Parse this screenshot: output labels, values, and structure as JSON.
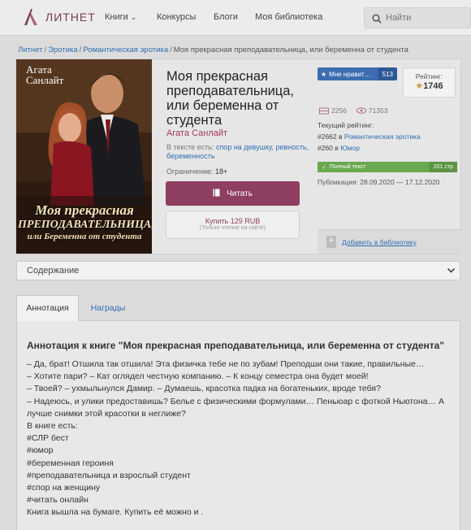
{
  "header": {
    "logo_text": "ЛИТНЕТ",
    "nav": {
      "books": "Книги",
      "contests": "Конкурсы",
      "blogs": "Блоги",
      "library": "Моя библиотека"
    },
    "search_placeholder": "Найти"
  },
  "breadcrumb": {
    "items": [
      "Литнет",
      "Эротика",
      "Романтическая эротика"
    ],
    "current": "Моя прекрасная преподавательница, или беременна от студента",
    "separator": "/"
  },
  "book": {
    "cover": {
      "author": [
        "Агата",
        "Санлайт"
      ],
      "title": [
        "Моя прекрасная",
        "ПРЕПОДАВАТЕЛЬНИЦА,",
        "или Беременна от студента"
      ]
    },
    "title": "Моя прекрасная преподавательница, или беременна от студента",
    "author": "Агата Санлайт",
    "tags_label": "В тексте есть:",
    "tags": "спор на девушку, ревность, беременность",
    "age_label": "Ограничение:",
    "age": "18+",
    "read_label": "Читать",
    "buy_label": "Купить 129 RUB",
    "buy_note": "(Только чтение на сайте)"
  },
  "stats": {
    "like_label": "Мне нравит…",
    "like_count": "513",
    "rating_label": "Рейтинг:",
    "rating_value": "1746",
    "library_count": "2256",
    "views_count": "71353",
    "current_rating_label": "Текущий рейтинг:",
    "rank1_number": "#2662",
    "rank1_in": "в",
    "rank1_genre": "Романтическая эротика",
    "rank2_number": "#260",
    "rank2_in": "в",
    "rank2_genre": "Юмор",
    "status": "Полный текст",
    "pages": "201 стр",
    "publication": "Публикация: 28.09.2020 — 17.12.2020",
    "add_library": "Добавить в библиотеку"
  },
  "contents": {
    "label": "Содержание"
  },
  "tabs": {
    "annotation": "Аннотация",
    "awards": "Награды"
  },
  "annotation": {
    "heading": "Аннотация к книге \"Моя прекрасная преподавательница, или беременна от студента\"",
    "lines": [
      "– Да, брат! Отшила так отшила! Эта физичка тебе не по зубам! Преподши они такие, правильные…",
      "– Хотите пари? – Кат оглядел честную компанию. – К концу семестра она будет моей!",
      "– Твоей? – ухмыльнулся Дамир. – Думаешь, красотка падка на богатеньких, вроде тебя?",
      "– Надеюсь, и улики предоставишь? Белье с физическими формулами… Пеньюар с фоткой Ньютона… А",
      "лучше снимки этой красотки в неглиже?",
      "В книге есть:",
      "#СЛР бест",
      "#юмор",
      "#беременная героиня",
      "#преподавательница и взрослый студент",
      "#спор на женщину",
      "#читать онлайн",
      "Книга вышла на бумаге. Купить её можно и ."
    ]
  },
  "colors": {
    "accent": "#8e3e60",
    "link": "#2f6fb3",
    "like": "#3d6cb0",
    "status": "#6aa84f"
  }
}
